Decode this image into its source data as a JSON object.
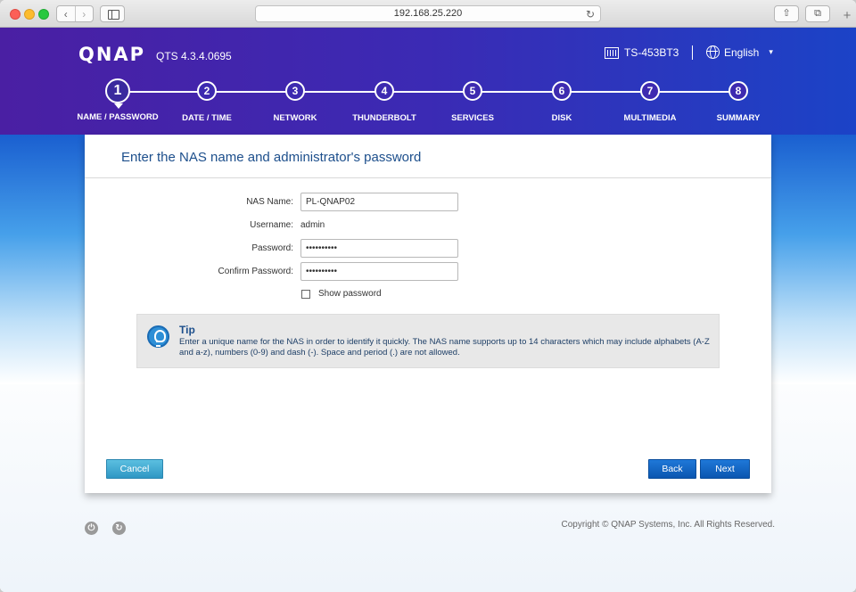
{
  "browser": {
    "url": "192.168.25.220",
    "nav_back": "‹",
    "nav_forward": "›",
    "reload": "↻",
    "share": "⇧",
    "tabs": "⧉",
    "new_tab": "+"
  },
  "header": {
    "brand": "QNAP",
    "version": "QTS 4.3.4.0695",
    "device": "TS-453BT3",
    "language": "English",
    "language_caret": "▾"
  },
  "steps": [
    {
      "number": "1",
      "label": "NAME / PASSWORD",
      "active": true
    },
    {
      "number": "2",
      "label": "DATE / TIME"
    },
    {
      "number": "3",
      "label": "NETWORK"
    },
    {
      "number": "4",
      "label": "THUNDERBOLT"
    },
    {
      "number": "5",
      "label": "SERVICES"
    },
    {
      "number": "6",
      "label": "DISK"
    },
    {
      "number": "7",
      "label": "MULTIMEDIA"
    },
    {
      "number": "8",
      "label": "SUMMARY"
    }
  ],
  "form": {
    "title": "Enter the NAS name and administrator's password",
    "nas_name_label": "NAS Name:",
    "nas_name_value": "PL-QNAP02",
    "username_label": "Username:",
    "username_value": "admin",
    "password_label": "Password:",
    "password_value": "••••••••••",
    "confirm_label": "Confirm Password:",
    "confirm_value": "••••••••••",
    "show_password_label": "Show password"
  },
  "tip": {
    "title": "Tip",
    "text": "Enter a unique name for the NAS in order to identify it quickly. The NAS name supports up to 14 characters which may include alphabets (A-Z and a-z), numbers (0-9) and dash (-). Space and period (.) are not allowed."
  },
  "buttons": {
    "cancel": "Cancel",
    "back": "Back",
    "next": "Next"
  },
  "footer": {
    "power_icon": "⏻",
    "restart_icon": "↻",
    "copyright": "Copyright © QNAP Systems, Inc. All Rights Reserved."
  },
  "colors": {
    "header_start": "#4a1fa3",
    "header_end": "#1b43c7",
    "accent_blue": "#1d4f8c",
    "button_primary": "#0b56b0",
    "button_cancel": "#2f97c4"
  }
}
